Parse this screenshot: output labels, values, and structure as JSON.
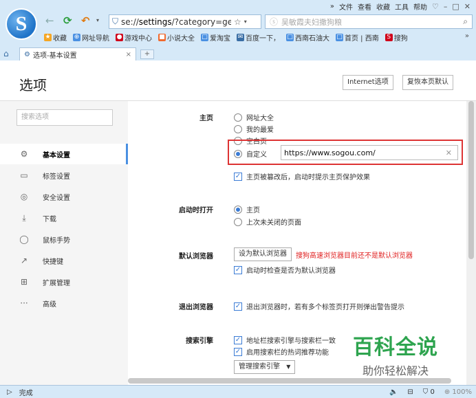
{
  "colors": {
    "chrome": "#d6e9f8",
    "accent": "#3a7bd5",
    "warn": "#e02020",
    "highlight": "#d33333",
    "watermark": "#2ea44f"
  },
  "topmenu": {
    "expand": "»",
    "items": [
      "文件",
      "查看",
      "收藏",
      "工具",
      "帮助"
    ],
    "skin": "♡",
    "min": "–",
    "max": "□",
    "close": "✕"
  },
  "address": {
    "url_prefix": "se://",
    "url_bold": "settings",
    "url_rest": "/?category=ge",
    "star": "☆"
  },
  "search": {
    "placeholder": "吴敏霞夫妇撒狗粮"
  },
  "bookmarks": [
    {
      "icon": "★",
      "label": "收藏",
      "color": "#f5a623"
    },
    {
      "icon": "⊕",
      "label": "网址导航",
      "color": "#4a90e2"
    },
    {
      "icon": "●",
      "label": "游戏中心",
      "color": "#d0021b"
    },
    {
      "icon": "■",
      "label": "小说大全",
      "color": "#f06a2e"
    },
    {
      "icon": "□",
      "label": "爱淘宝",
      "color": "#4a90e2"
    },
    {
      "icon": "✉",
      "label": "百度一下，",
      "color": "#3a6ea5"
    },
    {
      "icon": "□",
      "label": "西南石油大",
      "color": "#4a90e2"
    },
    {
      "icon": "□",
      "label": "首页 | 西南",
      "color": "#4a90e2"
    },
    {
      "icon": "S",
      "label": "搜狗",
      "color": "#d0021b"
    }
  ],
  "bookmarks_more": "»",
  "tab": {
    "label": "选项-基本设置",
    "close": "×",
    "new": "+"
  },
  "page": {
    "title": "选项",
    "btn_internet": "Internet选项",
    "btn_restore": "复恢本页默认"
  },
  "sidebar": {
    "search_placeholder": "搜索选项",
    "items": [
      {
        "icon": "⚙",
        "label": "基本设置"
      },
      {
        "icon": "▭",
        "label": "标签设置"
      },
      {
        "icon": "◎",
        "label": "安全设置"
      },
      {
        "icon": "⤓",
        "label": "下载"
      },
      {
        "icon": "◯",
        "label": "鼠标手势"
      },
      {
        "icon": "↗",
        "label": "快捷键"
      },
      {
        "icon": "⊞",
        "label": "扩展管理"
      },
      {
        "icon": "···",
        "label": "高级"
      }
    ]
  },
  "home": {
    "label": "主页",
    "options": [
      "网址大全",
      "我的最爱",
      "空白页",
      "自定义"
    ],
    "custom_url": "https://www.sogou.com/",
    "protect": "主页被篡改后，启动时提示主页保护效果"
  },
  "startup": {
    "label": "启动时打开",
    "options": [
      "主页",
      "上次未关闭的页面"
    ]
  },
  "default_browser": {
    "label": "默认浏览器",
    "button": "设为默认浏览器",
    "warning": "搜狗高速浏览器目前还不是默认浏览器",
    "check": "启动时检查是否为默认浏览器"
  },
  "exit": {
    "label": "退出浏览器",
    "check": "退出浏览器时，若有多个标签页打开则弹出警告提示"
  },
  "search_engine": {
    "label": "搜索引擎",
    "check1": "地址栏搜索引擎与搜索栏一致",
    "check2": "启用搜索栏的热词推荐功能",
    "manage": "管理搜索引擎"
  },
  "watermark": {
    "line1": "百科全说",
    "line2": "助你轻松解决"
  },
  "status": {
    "text": "完成",
    "count": "0",
    "zoom": "100%"
  }
}
